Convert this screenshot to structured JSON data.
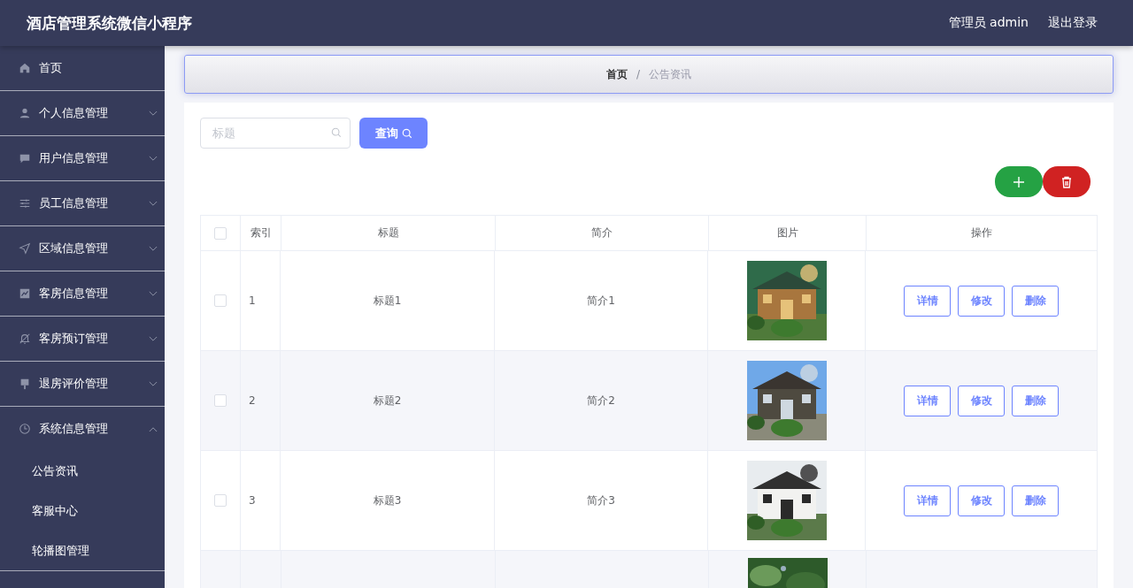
{
  "header": {
    "title": "酒店管理系统微信小程序",
    "user": "管理员 admin",
    "logout": "退出登录"
  },
  "sidebar": {
    "items": [
      {
        "label": "首页"
      },
      {
        "label": "个人信息管理",
        "expanded": false
      },
      {
        "label": "用户信息管理",
        "expanded": false
      },
      {
        "label": "员工信息管理",
        "expanded": false
      },
      {
        "label": "区域信息管理",
        "expanded": false
      },
      {
        "label": "客房信息管理",
        "expanded": false
      },
      {
        "label": "客房预订管理",
        "expanded": false
      },
      {
        "label": "退房评价管理",
        "expanded": false
      },
      {
        "label": "系统信息管理",
        "expanded": true,
        "children": [
          {
            "label": "公告资讯"
          },
          {
            "label": "客服中心"
          },
          {
            "label": "轮播图管理"
          }
        ]
      }
    ]
  },
  "breadcrumb": {
    "separator": "/",
    "items": [
      {
        "label": "首页",
        "current": false
      },
      {
        "label": "公告资讯",
        "current": true
      }
    ]
  },
  "search": {
    "placeholder": "标题",
    "button": "查询"
  },
  "table": {
    "all_checked": false,
    "columns": [
      "索引",
      "标题",
      "简介",
      "图片",
      "操作"
    ],
    "rows": [
      {
        "checked": false,
        "index": "1",
        "title": "标题1",
        "intro": "简介1",
        "actions": [
          "详情",
          "修改",
          "删除"
        ]
      },
      {
        "checked": false,
        "index": "2",
        "title": "标题2",
        "intro": "简介2",
        "actions": [
          "详情",
          "修改",
          "删除"
        ]
      },
      {
        "checked": false,
        "index": "3",
        "title": "标题3",
        "intro": "简介3",
        "actions": [
          "详情",
          "修改",
          "删除"
        ]
      }
    ]
  }
}
